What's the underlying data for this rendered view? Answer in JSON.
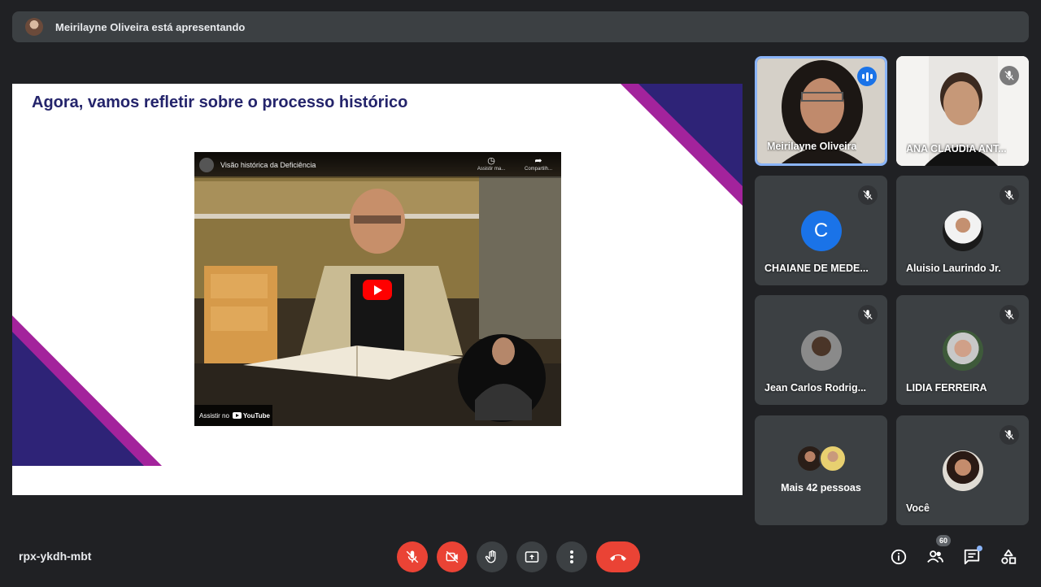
{
  "presenter_bar": {
    "text": "Meirilayne Oliveira está apresentando"
  },
  "slide": {
    "title": "Agora, vamos refletir sobre o processo histórico",
    "video": {
      "title": "Visão histórica da Deficiência",
      "watch_later": "Assistir ma...",
      "share": "Compartilh...",
      "watch_on": "Assistir no",
      "youtube": "YouTube"
    }
  },
  "participants": [
    {
      "name": "Meirilayne Oliveira",
      "speaking": true
    },
    {
      "name": "ANA CLAUDIA ANT...",
      "muted": true
    },
    {
      "name": "CHAIANE DE MEDE...",
      "muted": true,
      "initial": "C"
    },
    {
      "name": "Aluisio Laurindo Jr.",
      "muted": true
    },
    {
      "name": "Jean Carlos Rodrig...",
      "muted": true
    },
    {
      "name": "LIDIA FERREIRA",
      "muted": true
    },
    {
      "name": "Mais 42 pessoas"
    },
    {
      "name": "Você",
      "muted": true
    }
  ],
  "bottom_bar": {
    "meeting_code": "rpx-ykdh-mbt",
    "people_count": "60"
  },
  "colors": {
    "background": "#202124",
    "tile": "#3c4043",
    "end_call": "#ea4335",
    "active_border": "#8ab4f8",
    "slide_title": "#24246b",
    "slide_accent_navy": "#2e2377",
    "slide_accent_purple": "#a3239c"
  }
}
